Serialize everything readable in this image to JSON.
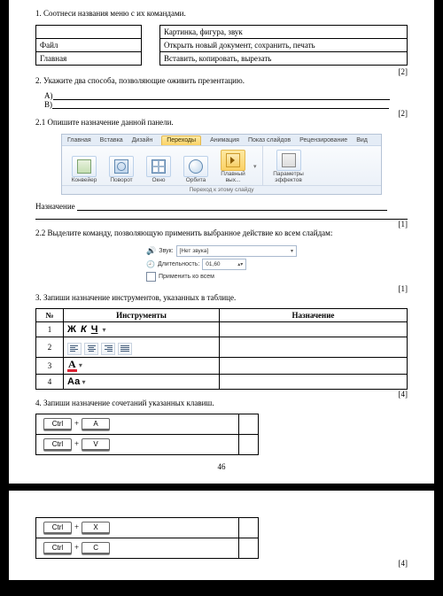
{
  "q1": {
    "prompt": "1. Соотнеси названия меню с их командами.",
    "left": [
      "Файл",
      "Главная"
    ],
    "right": [
      "Картинка, фигура, звук",
      "Открыть новый документ, сохранить, печать",
      "Вставить, копировать, вырезать"
    ],
    "points": "[2]"
  },
  "q2": {
    "prompt": "2. Укажите два способа, позволяющие оживить презентацию.",
    "a_label": "А)",
    "b_label": "В)",
    "points": "[2]"
  },
  "q2_1": {
    "prompt": "2.1 Опишите назначение данной панели.",
    "ribbon_tabs": [
      "Главная",
      "Вставка",
      "Дизайн",
      "Переходы",
      "Анимация",
      "Показ слайдов",
      "Рецензирование",
      "Вид"
    ],
    "ribbon_buttons": [
      "Конвейер",
      "Поворот",
      "Окно",
      "Орбита",
      "Плавный вых..."
    ],
    "ribbon_fx": "Параметры эффектов",
    "ribbon_footer": "Переход к этому слайду",
    "answer_label": "Назначение",
    "points": "[1]"
  },
  "q2_2": {
    "prompt": "2.2 Выделите команду, позволяющую применить выбранное действие ко всем слайдам:",
    "sound_label": "Звук:",
    "sound_value": "[Нет звука]",
    "dur_label": "Длительность:",
    "dur_value": "01,60",
    "apply_label": "Применить ко всем",
    "points": "[1]"
  },
  "q3": {
    "prompt": "3. Запиши назначение инструментов, указанных в таблице.",
    "h_num": "№",
    "h_tool": "Инструменты",
    "h_use": "Назначение",
    "rows": [
      "1",
      "2",
      "3",
      "4"
    ],
    "points": "[4]"
  },
  "q4": {
    "prompt": "4. Запиши назначение сочетаний указанных клавиш.",
    "keys_page1": [
      [
        "Ctrl",
        "A"
      ],
      [
        "Ctrl",
        "V"
      ]
    ],
    "keys_page2": [
      [
        "Ctrl",
        "X"
      ],
      [
        "Ctrl",
        "C"
      ]
    ],
    "points": "[4]"
  },
  "page_number": "46"
}
